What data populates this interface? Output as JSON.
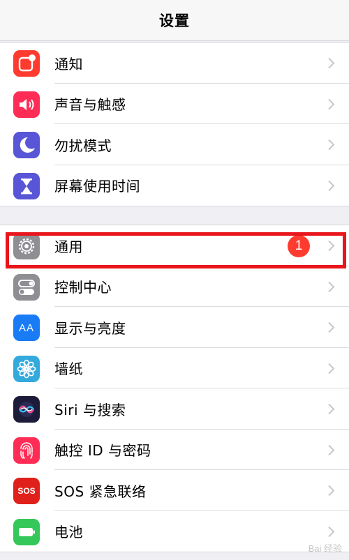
{
  "nav": {
    "title": "设置"
  },
  "group1": [
    {
      "label": "通知",
      "icon": "notifications-icon",
      "color": "#ff3b30"
    },
    {
      "label": "声音与触感",
      "icon": "sound-icon",
      "color": "#ff2d55"
    },
    {
      "label": "勿扰模式",
      "icon": "moon-icon",
      "color": "#5856d6"
    },
    {
      "label": "屏幕使用时间",
      "icon": "hourglass-icon",
      "color": "#5856d6"
    }
  ],
  "group2": [
    {
      "label": "通用",
      "icon": "gear-icon",
      "color": "#8e8e93",
      "badge": "1"
    },
    {
      "label": "控制中心",
      "icon": "toggles-icon",
      "color": "#8e8e93"
    },
    {
      "label": "显示与亮度",
      "icon": "text-size-icon",
      "color": "#1a7cf5",
      "glyph": "AA"
    },
    {
      "label": "墙纸",
      "icon": "flower-icon",
      "color": "#34aadc"
    },
    {
      "label": "Siri 与搜索",
      "icon": "siri-icon",
      "color": "#1c1c3a"
    },
    {
      "label": "触控 ID 与密码",
      "icon": "fingerprint-icon",
      "color": "#ff2d55"
    },
    {
      "label": "SOS 紧急联络",
      "icon": "sos-icon",
      "color": "#e0201a",
      "glyph": "SOS"
    },
    {
      "label": "电池",
      "icon": "battery-icon",
      "color": "#34c759"
    }
  ],
  "highlight_color": "#e8151b",
  "watermark": "Bai 经验"
}
